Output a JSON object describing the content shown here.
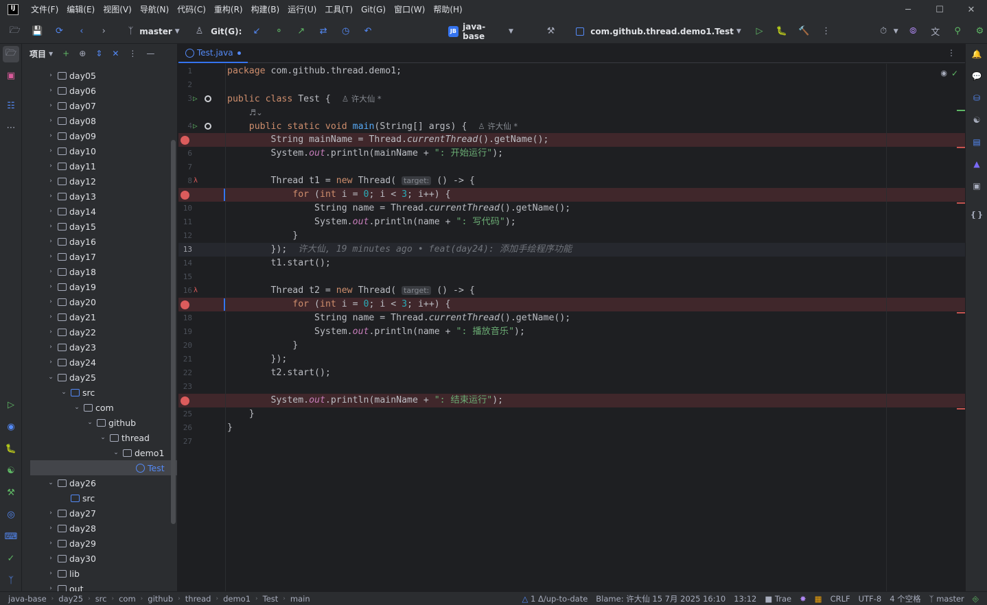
{
  "menu": {
    "items": [
      "文件(F)",
      "编辑(E)",
      "视图(V)",
      "导航(N)",
      "代码(C)",
      "重构(R)",
      "构建(B)",
      "运行(U)",
      "工具(T)",
      "Git(G)",
      "窗口(W)",
      "帮助(H)"
    ]
  },
  "window_controls": {
    "minimize": "─",
    "maximize": "☐",
    "close": "✕"
  },
  "toolbar": {
    "branch": "master",
    "git_label": "Git(G):",
    "project_badge": "JB",
    "project": "java-base",
    "run_config": "com.github.thread.demo1.Test"
  },
  "project_panel": {
    "title": "项目",
    "tree": [
      {
        "label": "day05",
        "depth": 0,
        "arrow": "›",
        "kind": "folder"
      },
      {
        "label": "day06",
        "depth": 0,
        "arrow": "›",
        "kind": "folder"
      },
      {
        "label": "day07",
        "depth": 0,
        "arrow": "›",
        "kind": "folder"
      },
      {
        "label": "day08",
        "depth": 0,
        "arrow": "›",
        "kind": "folder"
      },
      {
        "label": "day09",
        "depth": 0,
        "arrow": "›",
        "kind": "folder"
      },
      {
        "label": "day10",
        "depth": 0,
        "arrow": "›",
        "kind": "folder"
      },
      {
        "label": "day11",
        "depth": 0,
        "arrow": "›",
        "kind": "folder"
      },
      {
        "label": "day12",
        "depth": 0,
        "arrow": "›",
        "kind": "folder"
      },
      {
        "label": "day13",
        "depth": 0,
        "arrow": "›",
        "kind": "folder"
      },
      {
        "label": "day14",
        "depth": 0,
        "arrow": "›",
        "kind": "folder"
      },
      {
        "label": "day15",
        "depth": 0,
        "arrow": "›",
        "kind": "folder"
      },
      {
        "label": "day16",
        "depth": 0,
        "arrow": "›",
        "kind": "folder"
      },
      {
        "label": "day17",
        "depth": 0,
        "arrow": "›",
        "kind": "folder"
      },
      {
        "label": "day18",
        "depth": 0,
        "arrow": "›",
        "kind": "folder"
      },
      {
        "label": "day19",
        "depth": 0,
        "arrow": "›",
        "kind": "folder"
      },
      {
        "label": "day20",
        "depth": 0,
        "arrow": "›",
        "kind": "folder"
      },
      {
        "label": "day21",
        "depth": 0,
        "arrow": "›",
        "kind": "folder"
      },
      {
        "label": "day22",
        "depth": 0,
        "arrow": "›",
        "kind": "folder"
      },
      {
        "label": "day23",
        "depth": 0,
        "arrow": "›",
        "kind": "folder"
      },
      {
        "label": "day24",
        "depth": 0,
        "arrow": "›",
        "kind": "folder"
      },
      {
        "label": "day25",
        "depth": 0,
        "arrow": "⌄",
        "kind": "folder"
      },
      {
        "label": "src",
        "depth": 1,
        "arrow": "⌄",
        "kind": "src"
      },
      {
        "label": "com",
        "depth": 2,
        "arrow": "⌄",
        "kind": "package"
      },
      {
        "label": "github",
        "depth": 3,
        "arrow": "⌄",
        "kind": "package"
      },
      {
        "label": "thread",
        "depth": 4,
        "arrow": "⌄",
        "kind": "package"
      },
      {
        "label": "demo1",
        "depth": 5,
        "arrow": "⌄",
        "kind": "package"
      },
      {
        "label": "Test",
        "depth": 6,
        "arrow": "",
        "kind": "class",
        "selected": true
      },
      {
        "label": "day26",
        "depth": 0,
        "arrow": "⌄",
        "kind": "folder"
      },
      {
        "label": "src",
        "depth": 1,
        "arrow": "",
        "kind": "src"
      },
      {
        "label": "day27",
        "depth": 0,
        "arrow": "›",
        "kind": "folder"
      },
      {
        "label": "day28",
        "depth": 0,
        "arrow": "›",
        "kind": "folder"
      },
      {
        "label": "day29",
        "depth": 0,
        "arrow": "›",
        "kind": "folder"
      },
      {
        "label": "day30",
        "depth": 0,
        "arrow": "›",
        "kind": "folder"
      },
      {
        "label": "lib",
        "depth": 0,
        "arrow": "›",
        "kind": "folder"
      },
      {
        "label": "out",
        "depth": 0,
        "arrow": "›",
        "kind": "folder"
      }
    ]
  },
  "editor": {
    "tab": "Test.java",
    "author_hint": "许大仙 *",
    "hint_target": "target:",
    "lines": [
      {
        "n": "1",
        "html": "<span class='kw'>package</span> com.github.thread.demo1;"
      },
      {
        "n": "2",
        "html": ""
      },
      {
        "n": "3",
        "html": "<span class='kw'>public class</span> Test {  <span class='author'>&#9817; 许大仙 *</span>",
        "run": true
      },
      {
        "n": "",
        "html": "    <span class='author'>&#9836;⌄</span>"
      },
      {
        "n": "4",
        "html": "    <span class='kw'>public static void</span> <span class='fn'>main</span>(String[] args) {  <span class='author'>&#9817; 许大仙 *</span>",
        "run": true
      },
      {
        "n": "5",
        "html": "        String mainName = Thread.<span class='it'>currentThread</span>().getName();",
        "bp": true
      },
      {
        "n": "6",
        "html": "        System.<span class='fld it'>out</span>.println(mainName + <span class='str'>\": 开始运行\"</span>);"
      },
      {
        "n": "7",
        "html": ""
      },
      {
        "n": "8",
        "html": "        Thread t1 = <span class='kw'>new</span> Thread( <span class='hint'>target:</span> () -> {",
        "lambda": true
      },
      {
        "n": "9",
        "html": "            <span class='kw'>for</span> (<span class='kw'>int</span> i = <span class='num'>0</span>; i < <span class='num'>3</span>; i++) {",
        "bp": true
      },
      {
        "n": "10",
        "html": "                String name = Thread.<span class='it'>currentThread</span>().getName();"
      },
      {
        "n": "11",
        "html": "                System.<span class='fld it'>out</span>.println(name + <span class='str'>\": 写代码\"</span>);"
      },
      {
        "n": "12",
        "html": "            }"
      },
      {
        "n": "13",
        "html": "        });  <span class='blame'>许大仙, 19 minutes ago • feat(day24): 添加手绘程序功能</span>",
        "current": true
      },
      {
        "n": "14",
        "html": "        t1.start();"
      },
      {
        "n": "15",
        "html": ""
      },
      {
        "n": "16",
        "html": "        Thread t2 = <span class='kw'>new</span> Thread( <span class='hint'>target:</span> () -> {",
        "lambda": true
      },
      {
        "n": "17",
        "html": "            <span class='kw'>for</span> (<span class='kw'>int</span> i = <span class='num'>0</span>; i < <span class='num'>3</span>; i++) {",
        "bp": true
      },
      {
        "n": "18",
        "html": "                String name = Thread.<span class='it'>currentThread</span>().getName();"
      },
      {
        "n": "19",
        "html": "                System.<span class='fld it'>out</span>.println(name + <span class='str'>\": 播放音乐\"</span>);"
      },
      {
        "n": "20",
        "html": "            }"
      },
      {
        "n": "21",
        "html": "        });"
      },
      {
        "n": "22",
        "html": "        t2.start();"
      },
      {
        "n": "23",
        "html": ""
      },
      {
        "n": "24",
        "html": "        System.<span class='fld it'>out</span>.println(mainName + <span class='str'>\": 结束运行\"</span>);",
        "bp": true
      },
      {
        "n": "25",
        "html": "    }"
      },
      {
        "n": "26",
        "html": "}"
      },
      {
        "n": "27",
        "html": ""
      }
    ]
  },
  "statusbar": {
    "breadcrumbs": [
      "java-base",
      "day25",
      "src",
      "com",
      "github",
      "thread",
      "demo1",
      "Test",
      "main"
    ],
    "vcs_status": "1 Δ/up-to-date",
    "blame": "Blame: 许大仙 15 7月 2025 16:10",
    "caret": "13:12",
    "plugin": "Trae",
    "line_sep": "CRLF",
    "encoding": "UTF-8",
    "indent": "4 个空格",
    "branch": "master"
  }
}
